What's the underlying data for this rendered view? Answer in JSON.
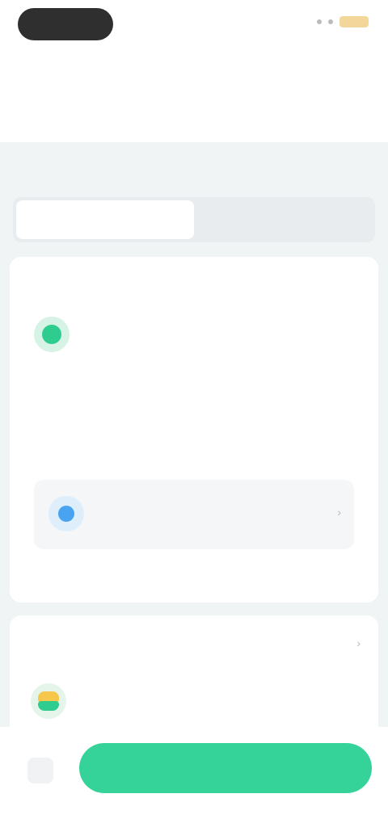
{
  "status_bar": {
    "time": "",
    "indicators": [
      "signal",
      "wifi",
      "battery"
    ]
  },
  "header": {
    "title": "",
    "right_action": ""
  },
  "tabs": [
    {
      "label": "",
      "active": true
    },
    {
      "label": "",
      "active": false
    },
    {
      "label": "",
      "active": false
    },
    {
      "label": "",
      "active": false
    }
  ],
  "section": {
    "title": ""
  },
  "segment": {
    "items": [
      {
        "label": "",
        "active": true
      },
      {
        "label": "",
        "active": false
      }
    ]
  },
  "card1": {
    "title": "",
    "row": {
      "sub_label": "",
      "sub_bold": "",
      "main": ""
    },
    "small_label": "",
    "description": "",
    "info_box": {
      "title": "",
      "subtitle": ""
    },
    "link_label": ""
  },
  "card2": {
    "title": "",
    "sub": "",
    "main": ""
  },
  "bottom": {
    "cta_label": ""
  },
  "colors": {
    "accent": "#2ecc8f",
    "cta": "#35d39a",
    "background": "#f1f4f5",
    "card": "#ffffff",
    "info_blue": "#4aa3f0"
  },
  "icons": {
    "row_icon": "green-circle-icon",
    "info_icon": "blue-circle-icon",
    "card2_icon": "yellow-green-icon",
    "bottom_icon": "home-icon",
    "chevron": "chevron-right-icon"
  }
}
